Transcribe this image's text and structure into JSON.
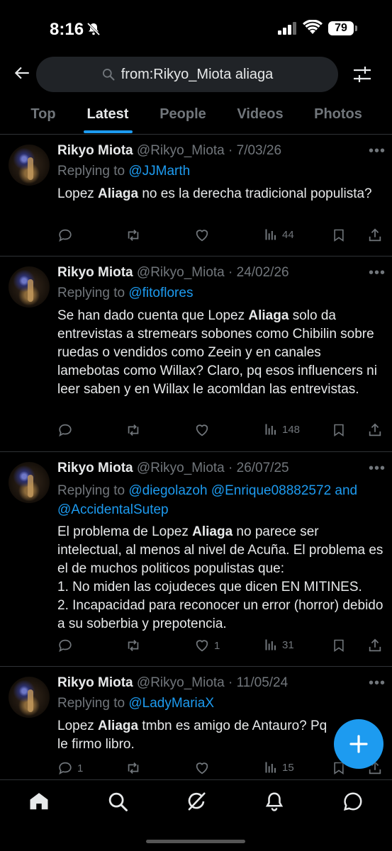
{
  "status_bar": {
    "time": "8:16",
    "battery": "79"
  },
  "search": {
    "query": "from:Rikyo_Miota aliaga"
  },
  "tabs": [
    {
      "label": "Top"
    },
    {
      "label": "Latest"
    },
    {
      "label": "People"
    },
    {
      "label": "Videos"
    },
    {
      "label": "Photos"
    }
  ],
  "active_tab": "Latest",
  "tweets": [
    {
      "name": "Rikyo Miota",
      "handle": "@Rikyo_Miota",
      "date": "· 7/03/26",
      "replying_prefix": "Replying to ",
      "replying_to": "@JJMarth",
      "body_parts": [
        "Lopez ",
        "Aliaga",
        " no es la derecha tradicional populista?"
      ],
      "replies": "",
      "retweets": "",
      "likes": "",
      "views": "44"
    },
    {
      "name": "Rikyo Miota",
      "handle": "@Rikyo_Miota",
      "date": "· 24/02/26",
      "replying_prefix": "Replying to ",
      "replying_to": "@fitoflores",
      "body_parts": [
        "Se han dado cuenta que Lopez ",
        "Aliaga",
        " solo da entrevistas a stremears sobones como Chibilin sobre ruedas o vendidos como Zeein y en canales lamebotas como Willax? Claro, pq esos influencers ni leer saben y en Willax le acomldan las entrevistas."
      ],
      "replies": "",
      "retweets": "",
      "likes": "",
      "views": "148"
    },
    {
      "name": "Rikyo Miota",
      "handle": "@Rikyo_Miota",
      "date": "· 26/07/25",
      "replying_prefix": "Replying to ",
      "replying_to": "@diegolazoh @Enrique08882572 and @AccidentalSutep",
      "body_parts": [
        "El problema de Lopez ",
        "Aliaga",
        " no parece ser intelectual, al menos al nivel de Acuña. El problema es el de muchos politicos populistas que:\n1. No miden las cojudeces que dicen EN MITINES.\n2. Incapacidad para reconocer un error (horror) debido a su soberbia y prepotencia."
      ],
      "replies": "",
      "retweets": "",
      "likes": "1",
      "views": "31"
    },
    {
      "name": "Rikyo Miota",
      "handle": "@Rikyo_Miota",
      "date": "· 11/05/24",
      "replying_prefix": "Replying to ",
      "replying_to": "@LadyMariaX",
      "body_parts": [
        "Lopez ",
        "Aliaga",
        " tmbn es amigo de Antauro? Pq le firmo libro."
      ],
      "replies": "1",
      "retweets": "",
      "likes": "",
      "views": "15"
    }
  ],
  "colors": {
    "accent": "#1d9bf0",
    "background": "#000000",
    "muted": "#71767b",
    "text": "#e7e9ea"
  },
  "icons": [
    "back-arrow-icon",
    "search-icon",
    "filter-sliders-icon",
    "more-icon",
    "reply-icon",
    "retweet-icon",
    "like-icon",
    "views-icon",
    "bookmark-icon",
    "share-icon",
    "compose-plus-icon",
    "home-icon",
    "explore-icon",
    "grok-icon",
    "notifications-icon",
    "messages-icon"
  ]
}
